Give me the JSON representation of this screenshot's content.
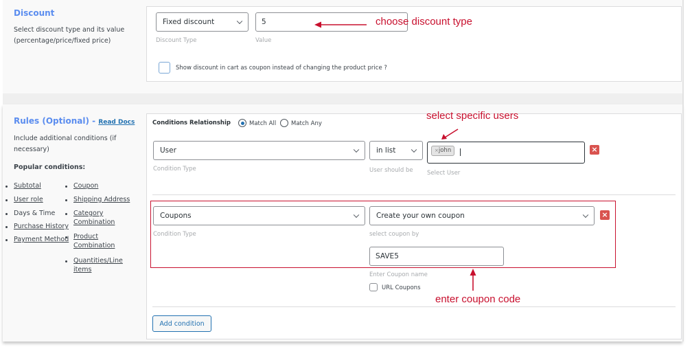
{
  "discount": {
    "title": "Discount",
    "description_line1": "Select discount type and its value",
    "description_line2": "(percentage/price/fixed price)",
    "type_select": {
      "value": "Fixed discount",
      "hint": "Discount Type"
    },
    "value_input": {
      "value": "5",
      "hint": "Value"
    },
    "show_as_coupon": {
      "checked": false,
      "label": "Show discount in cart as coupon instead of changing the product price ?"
    }
  },
  "rules": {
    "title": "Rules (Optional) - ",
    "read_docs_link": "Read Docs",
    "description_line1": "Include additional conditions (if",
    "description_line2": "necessary)",
    "popular_heading": "Popular conditions:",
    "popular_left": [
      "Subtotal",
      "User role",
      "Days & Time",
      "Purchase History",
      "Payment Method"
    ],
    "popular_right": [
      "Coupon",
      "Shipping Address",
      "Category",
      "Combination",
      "Product",
      "Combination",
      "Quantities/Line",
      "items"
    ],
    "relationship": {
      "label": "Conditions Relationship",
      "options": [
        "Match All",
        "Match Any"
      ],
      "selected": "Match All"
    },
    "conditions": [
      {
        "type": "User",
        "type_hint": "Condition Type",
        "operator": "in list",
        "operator_hint": "User should be",
        "users": [
          "john"
        ],
        "user_hint": "Select User"
      },
      {
        "type": "Coupons",
        "type_hint": "Condition Type",
        "coupon_select": "Create your own coupon",
        "coupon_select_hint": "select coupon by",
        "coupon_code": "SAVE5",
        "coupon_code_hint": "Enter Coupon name",
        "url_coupons_label": "URL Coupons",
        "url_coupons_checked": false
      }
    ],
    "add_condition_label": "Add condition"
  },
  "annotations": {
    "discount_type": "choose discount type",
    "specific_users": "select specific users",
    "coupon_code": "enter coupon code",
    "color": "#c8102e"
  },
  "icons": {
    "remove": "×",
    "tag_remove": "×"
  }
}
